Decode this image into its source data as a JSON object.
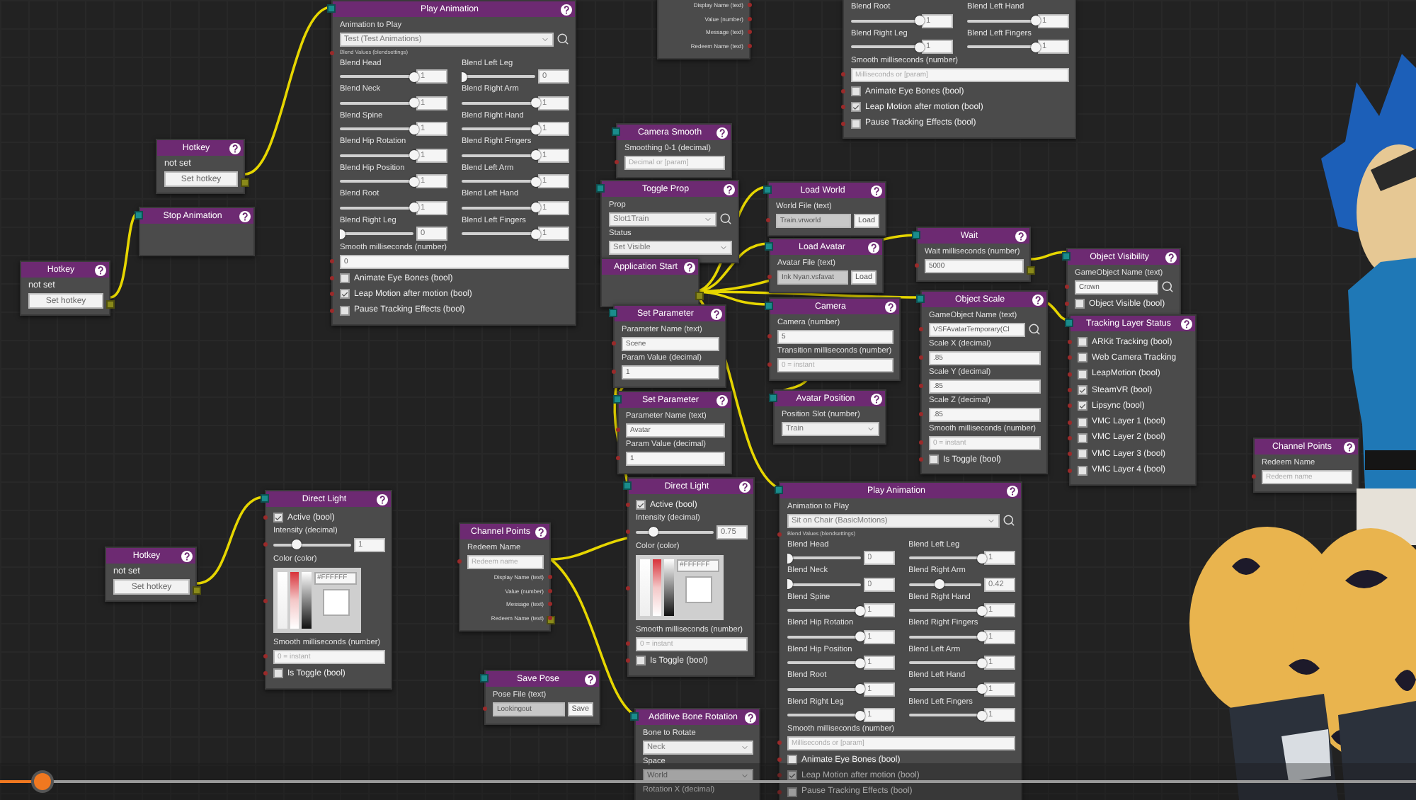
{
  "nodes": [
    {
      "title": "Play Animation",
      "input_port": true,
      "rows": [
        {
          "kind": "caption",
          "text": "Animation to Play"
        },
        {
          "kind": "select",
          "value": "Test (Test Animations)",
          "search": true
        },
        {
          "kind": "tiny",
          "text": "Blend Values (blendsettings)"
        },
        {
          "kind": "blends",
          "left": [
            {
              "label": "Blend Head",
              "level": 1,
              "value": "1"
            },
            {
              "label": "Blend Neck",
              "level": 1,
              "value": "1"
            },
            {
              "label": "Blend Spine",
              "level": 1,
              "value": "1"
            },
            {
              "label": "Blend Hip Rotation",
              "level": 1,
              "value": "1"
            },
            {
              "label": "Blend Hip Position",
              "level": 1,
              "value": "1"
            },
            {
              "label": "Blend Root",
              "level": 1,
              "value": "1"
            },
            {
              "label": "Blend Right Leg",
              "level": 0,
              "value": "0"
            }
          ],
          "right": [
            {
              "label": "Blend Left Leg",
              "level": 0,
              "value": "0"
            },
            {
              "label": "Blend Right Arm",
              "level": 1,
              "value": "1"
            },
            {
              "label": "Blend Right Hand",
              "level": 1,
              "value": "1"
            },
            {
              "label": "Blend Right Fingers",
              "level": 1,
              "value": "1"
            },
            {
              "label": "Blend Left Arm",
              "level": 1,
              "value": "1"
            },
            {
              "label": "Blend Left Hand",
              "level": 1,
              "value": "1"
            },
            {
              "label": "Blend Left Fingers",
              "level": 1,
              "value": "1"
            }
          ]
        },
        {
          "kind": "caption",
          "text": "Smooth milliseconds (number)"
        },
        {
          "kind": "input",
          "value": "0",
          "readonly": false
        },
        {
          "kind": "check",
          "label": "Animate Eye Bones (bool)",
          "checked": false
        },
        {
          "kind": "check",
          "label": "Leap Motion after motion (bool)",
          "checked": true
        },
        {
          "kind": "check",
          "label": "Pause Tracking Effects (bool)",
          "checked": false
        }
      ]
    },
    {
      "rows": [
        {
          "kind": "outputs",
          "items": [
            "Display Name (text)",
            "Value (number)",
            "Message (text)",
            "Redeem Name (text)"
          ]
        }
      ]
    },
    {
      "rows": [
        {
          "kind": "blends",
          "left": [
            {
              "label": "Blend Root",
              "level": 1,
              "value": "1"
            },
            {
              "label": "Blend Right Leg",
              "level": 1,
              "value": "1"
            }
          ],
          "right": [
            {
              "label": "Blend Left Hand",
              "level": 1,
              "value": "1"
            },
            {
              "label": "Blend Left Fingers",
              "level": 1,
              "value": "1"
            }
          ]
        },
        {
          "kind": "caption",
          "text": "Smooth milliseconds (number)"
        },
        {
          "kind": "input",
          "placeholder": "Milliseconds or [param]",
          "readonly": false
        },
        {
          "kind": "check",
          "label": "Animate Eye Bones (bool)",
          "checked": false
        },
        {
          "kind": "check",
          "label": "Leap Motion after motion (bool)",
          "checked": true
        },
        {
          "kind": "check",
          "label": "Pause Tracking Effects (bool)",
          "checked": false
        }
      ]
    },
    {
      "title": "Hotkey",
      "output_port": true,
      "rows": [
        {
          "kind": "status",
          "text": "not set"
        },
        {
          "kind": "button",
          "text": "Set hotkey"
        }
      ]
    },
    {
      "title": "Stop Animation",
      "input_port": true
    },
    {
      "title": "Hotkey",
      "output_port": true,
      "rows": [
        {
          "kind": "status",
          "text": "not set"
        },
        {
          "kind": "button",
          "text": "Set hotkey"
        }
      ]
    },
    {
      "title": "Camera Smooth",
      "input_port": true,
      "rows": [
        {
          "kind": "caption",
          "text": "Smoothing 0-1 (decimal)"
        },
        {
          "kind": "input",
          "placeholder": "Decimal or [param]",
          "readonly": false
        }
      ]
    },
    {
      "title": "Toggle Prop",
      "input_port": true,
      "rows": [
        {
          "kind": "caption",
          "text": "Prop"
        },
        {
          "kind": "select",
          "value": "Slot1Train",
          "search": true
        },
        {
          "kind": "caption",
          "text": "Status"
        },
        {
          "kind": "select",
          "value": "Set Visible"
        }
      ]
    },
    {
      "title": "Application Start",
      "output_port": true
    },
    {
      "title": "Load World",
      "input_port": true,
      "rows": [
        {
          "kind": "caption",
          "text": "World File (text)"
        },
        {
          "kind": "input",
          "value": "Train.vrworld",
          "readonly": true,
          "button": "Load"
        }
      ]
    },
    {
      "title": "Load Avatar",
      "input_port": true,
      "rows": [
        {
          "kind": "caption",
          "text": "Avatar File (text)"
        },
        {
          "kind": "input",
          "value": "Ink Nyan.vsfavat",
          "readonly": true,
          "button": "Load"
        }
      ]
    },
    {
      "title": "Wait",
      "input_port": true,
      "output_port": true,
      "rows": [
        {
          "kind": "caption",
          "text": "Wait milliseconds (number)"
        },
        {
          "kind": "input",
          "value": "5000",
          "readonly": false
        }
      ]
    },
    {
      "title": "Object Visibility",
      "input_port": true,
      "rows": [
        {
          "kind": "caption",
          "text": "GameObject Name (text)"
        },
        {
          "kind": "input",
          "value": "Crown",
          "readonly": false,
          "search": true
        },
        {
          "kind": "check",
          "label": "Object Visible (bool)",
          "checked": false
        }
      ]
    },
    {
      "title": "Object Scale",
      "input_port": true,
      "rows": [
        {
          "kind": "caption",
          "text": "GameObject Name (text)"
        },
        {
          "kind": "input",
          "value": "VSFAvatarTemporary(Cl",
          "readonly": false,
          "search": true
        },
        {
          "kind": "caption",
          "text": "Scale X (decimal)"
        },
        {
          "kind": "input",
          "value": ".85",
          "readonly": false
        },
        {
          "kind": "caption",
          "text": "Scale Y (decimal)"
        },
        {
          "kind": "input",
          "value": ".85",
          "readonly": false
        },
        {
          "kind": "caption",
          "text": "Scale Z (decimal)"
        },
        {
          "kind": "input",
          "value": ".85",
          "readonly": false
        },
        {
          "kind": "caption",
          "text": "Smooth milliseconds (number)"
        },
        {
          "kind": "input",
          "placeholder": "0 = instant",
          "readonly": false
        },
        {
          "kind": "check",
          "label": "Is Toggle (bool)",
          "checked": false
        }
      ]
    },
    {
      "title": "Tracking Layer Status",
      "input_port": true,
      "rows": [
        {
          "kind": "check",
          "label": "ARKit Tracking (bool)",
          "checked": false
        },
        {
          "kind": "check",
          "label": "Web Camera Tracking",
          "checked": false
        },
        {
          "kind": "check",
          "label": "LeapMotion (bool)",
          "checked": false
        },
        {
          "kind": "check",
          "label": "SteamVR (bool)",
          "checked": true
        },
        {
          "kind": "check",
          "label": "Lipsync (bool)",
          "checked": true
        },
        {
          "kind": "check",
          "label": "VMC Layer 1 (bool)",
          "checked": false
        },
        {
          "kind": "check",
          "label": "VMC Layer 2 (bool)",
          "checked": false
        },
        {
          "kind": "check",
          "label": "VMC Layer 3 (bool)",
          "checked": false
        },
        {
          "kind": "check",
          "label": "VMC Layer 4 (bool)",
          "checked": false
        }
      ]
    },
    {
      "title": "Set Parameter",
      "input_port": true,
      "rows": [
        {
          "kind": "caption",
          "text": "Parameter Name (text)"
        },
        {
          "kind": "input",
          "value": "Scene",
          "readonly": false
        },
        {
          "kind": "caption",
          "text": "Param Value (decimal)"
        },
        {
          "kind": "input",
          "value": "1",
          "readonly": false
        }
      ]
    },
    {
      "title": "Camera",
      "input_port": true,
      "rows": [
        {
          "kind": "caption",
          "text": "Camera (number)"
        },
        {
          "kind": "input",
          "value": "5",
          "readonly": false
        },
        {
          "kind": "caption",
          "text": "Transition milliseconds (number)"
        },
        {
          "kind": "input",
          "placeholder": "0 = instant",
          "readonly": false
        }
      ]
    },
    {
      "title": "Set Parameter",
      "input_port": true,
      "rows": [
        {
          "kind": "caption",
          "text": "Parameter Name (text)"
        },
        {
          "kind": "input",
          "value": "Avatar",
          "readonly": false
        },
        {
          "kind": "caption",
          "text": "Param Value (decimal)"
        },
        {
          "kind": "input",
          "value": "1",
          "readonly": false
        }
      ]
    },
    {
      "title": "Avatar Position",
      "input_port": true,
      "rows": [
        {
          "kind": "caption",
          "text": "Position Slot (number)"
        },
        {
          "kind": "select",
          "value": "Train"
        }
      ]
    },
    {
      "title": "Direct Light",
      "input_port": true,
      "rows": [
        {
          "kind": "check",
          "label": "Active (bool)",
          "checked": true
        },
        {
          "kind": "caption",
          "text": "Intensity (decimal)"
        },
        {
          "kind": "slider",
          "level": 0.22,
          "value": "0.75"
        },
        {
          "kind": "caption",
          "text": "Color (color)"
        },
        {
          "kind": "color",
          "value": "#FFFFFF"
        },
        {
          "kind": "caption",
          "text": "Smooth milliseconds (number)"
        },
        {
          "kind": "input",
          "placeholder": "0 = instant",
          "readonly": false
        },
        {
          "kind": "check",
          "label": "Is Toggle (bool)",
          "checked": false
        }
      ]
    },
    {
      "title": "Additive Bone Rotation",
      "input_port": true,
      "rows": [
        {
          "kind": "caption",
          "text": "Bone to Rotate"
        },
        {
          "kind": "select",
          "value": "Neck"
        },
        {
          "kind": "caption",
          "text": "Space"
        },
        {
          "kind": "select",
          "value": "World"
        },
        {
          "kind": "caption",
          "text": "Rotation X (decimal)"
        }
      ]
    },
    {
      "title": "Play Animation",
      "input_port": true,
      "rows": [
        {
          "kind": "caption",
          "text": "Animation to Play"
        },
        {
          "kind": "select",
          "value": "Sit on Chair (BasicMotions)",
          "search": true
        },
        {
          "kind": "tiny",
          "text": "Blend Values (blendsettings)"
        },
        {
          "kind": "blends",
          "left": [
            {
              "label": "Blend Head",
              "level": 0,
              "value": "0"
            },
            {
              "label": "Blend Neck",
              "level": 0,
              "value": "0"
            },
            {
              "label": "Blend Spine",
              "level": 1,
              "value": "1"
            },
            {
              "label": "Blend Hip Rotation",
              "level": 1,
              "value": "1"
            },
            {
              "label": "Blend Hip Position",
              "level": 1,
              "value": "1"
            },
            {
              "label": "Blend Root",
              "level": 1,
              "value": "1"
            },
            {
              "label": "Blend Right Leg",
              "level": 1,
              "value": "1"
            }
          ],
          "right": [
            {
              "label": "Blend Left Leg",
              "level": 1,
              "value": "1"
            },
            {
              "label": "Blend Right Arm",
              "level": 0.42,
              "value": "0.42"
            },
            {
              "label": "Blend Right Hand",
              "level": 1,
              "value": "1"
            },
            {
              "label": "Blend Right Fingers",
              "level": 1,
              "value": "1"
            },
            {
              "label": "Blend Left Arm",
              "level": 1,
              "value": "1"
            },
            {
              "label": "Blend Left Hand",
              "level": 1,
              "value": "1"
            },
            {
              "label": "Blend Left Fingers",
              "level": 1,
              "value": "1"
            }
          ]
        },
        {
          "kind": "caption",
          "text": "Smooth milliseconds (number)"
        },
        {
          "kind": "input",
          "placeholder": "Milliseconds or [param]",
          "readonly": false
        },
        {
          "kind": "check",
          "label": "Animate Eye Bones (bool)",
          "checked": false
        },
        {
          "kind": "check",
          "label": "Leap Motion after motion (bool)",
          "checked": true
        },
        {
          "kind": "check",
          "label": "Pause Tracking Effects (bool)",
          "checked": false
        }
      ]
    },
    {
      "title": "Channel Points",
      "output_port": true,
      "rows": [
        {
          "kind": "caption",
          "text": "Redeem Name"
        },
        {
          "kind": "input",
          "placeholder": "Redeem name",
          "readonly": false
        },
        {
          "kind": "outputs",
          "items": [
            "Display Name (text)",
            "Value (number)",
            "Message (text)",
            "Redeem Name (text)"
          ]
        }
      ]
    },
    {
      "title": "Save Pose",
      "input_port": true,
      "rows": [
        {
          "kind": "caption",
          "text": "Pose File (text)"
        },
        {
          "kind": "input",
          "value": "Lookingout",
          "readonly": true,
          "button": "Save"
        }
      ]
    },
    {
      "title": "Direct Light",
      "input_port": true,
      "rows": [
        {
          "kind": "check",
          "label": "Active (bool)",
          "checked": true
        },
        {
          "kind": "caption",
          "text": "Intensity (decimal)"
        },
        {
          "kind": "slider",
          "level": 0.3,
          "value": "1"
        },
        {
          "kind": "caption",
          "text": "Color (color)"
        },
        {
          "kind": "color",
          "value": "#FFFFFF"
        },
        {
          "kind": "caption",
          "text": "Smooth milliseconds (number)"
        },
        {
          "kind": "input",
          "placeholder": "0 = instant",
          "readonly": false
        },
        {
          "kind": "check",
          "label": "Is Toggle (bool)",
          "checked": false
        }
      ]
    },
    {
      "title": "Hotkey",
      "output_port": true,
      "rows": [
        {
          "kind": "status",
          "text": "not set"
        },
        {
          "kind": "button",
          "text": "Set hotkey"
        }
      ]
    },
    {
      "title": "Channel Points",
      "rows": [
        {
          "kind": "caption",
          "text": "Redeem Name"
        },
        {
          "kind": "input",
          "placeholder": "Redeem name",
          "readonly": false
        }
      ]
    }
  ],
  "timeline": {
    "level": 0.03
  }
}
